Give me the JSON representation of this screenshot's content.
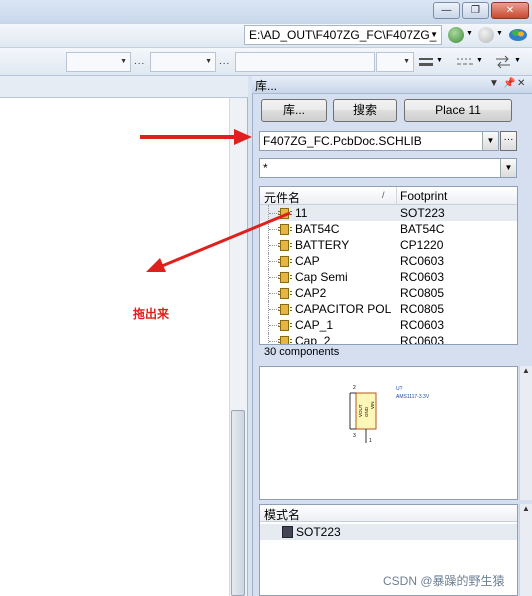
{
  "window": {
    "minimize": "—",
    "restore": "❐",
    "close": "✕"
  },
  "toolbar": {
    "path": "E:\\AD_OUT\\F407ZG_FC\\F407ZG_",
    "dots": "...",
    "dots2": "...",
    "dots3": "..."
  },
  "panel": {
    "title": "库...",
    "buttons": {
      "library": "库...",
      "search": "搜索",
      "place": "Place 11"
    },
    "library_select": "F407ZG_FC.PcbDoc.SCHLIB",
    "filter": "*",
    "columns": {
      "name": "元件名",
      "footprint": "Footprint"
    },
    "components": [
      {
        "name": "11",
        "footprint": "SOT223"
      },
      {
        "name": "BAT54C",
        "footprint": "BAT54C"
      },
      {
        "name": "BATTERY",
        "footprint": "CP1220"
      },
      {
        "name": "CAP",
        "footprint": "RC0603"
      },
      {
        "name": "Cap Semi",
        "footprint": "RC0603"
      },
      {
        "name": "CAP2",
        "footprint": "RC0805"
      },
      {
        "name": "CAPACITOR POL",
        "footprint": "RC0805"
      },
      {
        "name": "CAP_1",
        "footprint": "RC0603"
      },
      {
        "name": "Cap_2",
        "footprint": "RC0603"
      }
    ],
    "count": "30 components",
    "preview": {
      "designator": "U?",
      "comment": "AMS1117-3.3V",
      "pin_vin": "VIN",
      "pin_vout": "VOUT",
      "pin_gnd": "GND",
      "pin2": "2",
      "pin3": "3",
      "pin1": "1"
    },
    "model": {
      "column": "模式名",
      "item": "SOT223"
    }
  },
  "annotation": "拖出来",
  "watermark": "CSDN @暴躁的野生猿",
  "colors": {
    "arrow": "#e0201c",
    "panel_bg": "#d5dff0"
  }
}
